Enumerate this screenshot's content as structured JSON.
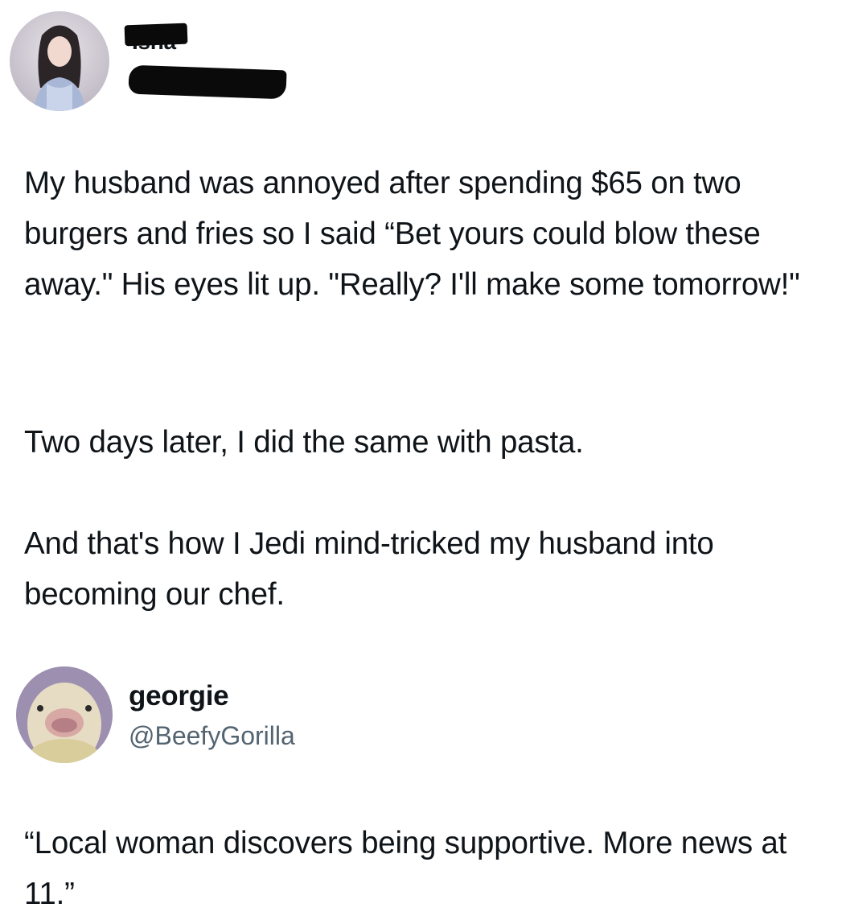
{
  "tweet1": {
    "author": {
      "display_name": "Isha",
      "avatar": "woman-photo-avatar"
    },
    "paragraphs": [
      "My husband was annoyed after spending $65 on two burgers and fries so I said “Bet yours could blow these away.\" His eyes lit up. \"Really? I'll make some tomorrow!\"",
      "Two days later, I did the same with pasta.",
      "And that's how I Jedi mind-tricked my husband into becoming our chef."
    ]
  },
  "tweet2": {
    "author": {
      "display_name": "georgie",
      "handle": "@BeefyGorilla",
      "avatar": "bird-face-avatar"
    },
    "paragraphs": [
      "“Local woman discovers being supportive. More news at 11.”"
    ]
  }
}
